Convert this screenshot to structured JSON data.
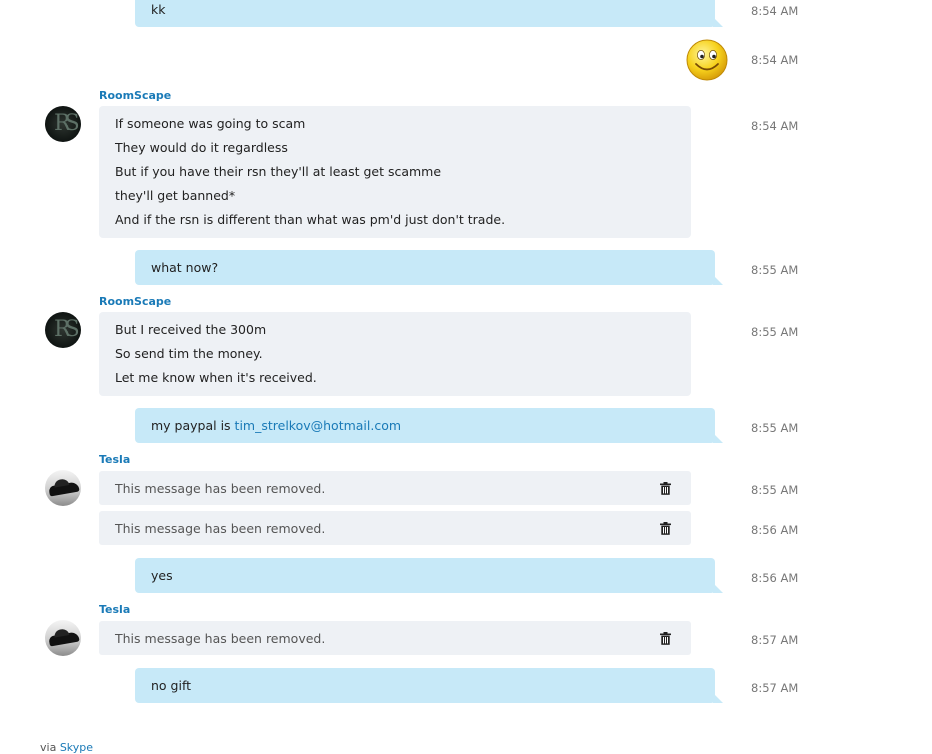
{
  "messages": [
    {
      "kind": "out",
      "text": "kk",
      "time": "8:54 AM"
    },
    {
      "kind": "out-emoji",
      "emoji": "smile-emoji",
      "time": "8:54 AM"
    },
    {
      "kind": "in",
      "sender": "RoomScape",
      "lines": [
        "If someone was going to scam",
        "They would do it regardless",
        "But if you have their rsn they'll at least get scamme",
        "they'll get banned*",
        "And if the rsn is different than what was pm'd just don't trade."
      ],
      "time": "8:54 AM"
    },
    {
      "kind": "out",
      "text": "what now?",
      "time": "8:55 AM"
    },
    {
      "kind": "in",
      "sender": "RoomScape",
      "lines": [
        "But I received the 300m",
        "So send tim the money.",
        "Let me know when it's received."
      ],
      "time": "8:55 AM"
    },
    {
      "kind": "out",
      "text_prefix": "my paypal is ",
      "link": "tim_strelkov@hotmail.com",
      "time": "8:55 AM"
    },
    {
      "kind": "removed",
      "sender": "Tesla",
      "text": "This message has been removed.",
      "time": "8:55 AM"
    },
    {
      "kind": "removed",
      "text": "This message has been removed.",
      "time": "8:56 AM"
    },
    {
      "kind": "out",
      "text": "yes",
      "time": "8:56 AM"
    },
    {
      "kind": "removed",
      "sender": "Tesla",
      "text": "This message has been removed.",
      "time": "8:57 AM"
    },
    {
      "kind": "out",
      "text": "no gift",
      "time": "8:57 AM"
    }
  ],
  "footer": {
    "via_label": "via ",
    "via_link": "Skype"
  },
  "colors": {
    "outgoing": "#c7e9f8",
    "incoming": "#eef1f5",
    "sender": "#1a7ab7",
    "link": "#1a7ab7"
  },
  "icons": {
    "delete": "trash-icon",
    "emoji": "smile-emoji"
  }
}
